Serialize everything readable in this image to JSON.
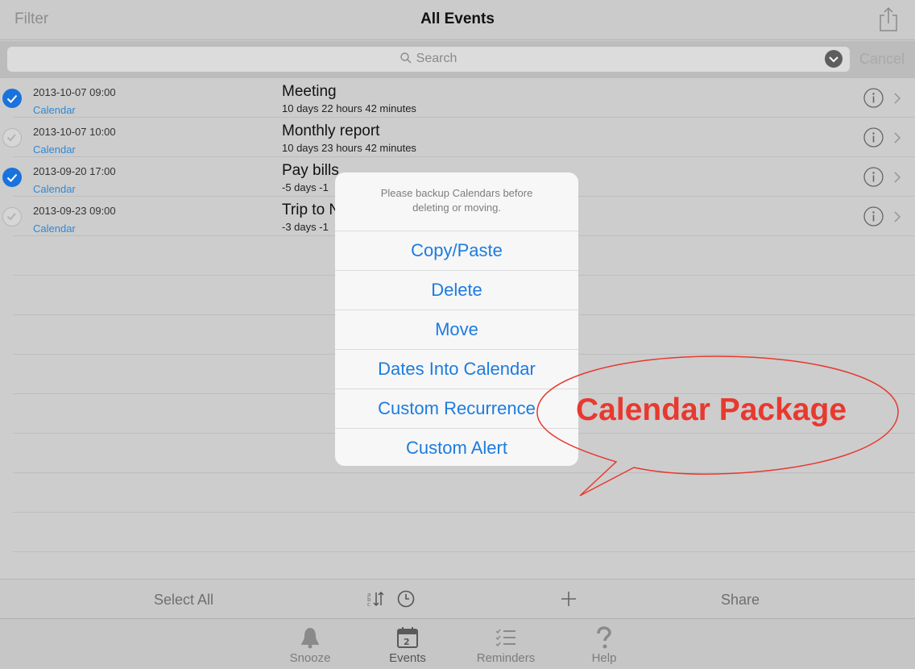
{
  "navbar": {
    "filter_label": "Filter",
    "title": "All Events",
    "share_icon": "share-icon"
  },
  "search": {
    "placeholder": "Search",
    "cancel_label": "Cancel"
  },
  "events": [
    {
      "date": "2013-10-07 09:00",
      "calendar": "Calendar",
      "title": "Meeting",
      "remaining": "10 days  22 hours  42 minutes",
      "checked": true
    },
    {
      "date": "2013-10-07 10:00",
      "calendar": "Calendar",
      "title": "Monthly report",
      "remaining": "10 days  23 hours  42 minutes",
      "checked": false
    },
    {
      "date": "2013-09-20 17:00",
      "calendar": "Calendar",
      "title": "Pay bills",
      "remaining": "-5 days  -1",
      "checked": true
    },
    {
      "date": "2013-09-23 09:00",
      "calendar": "Calendar",
      "title": "Trip to N",
      "remaining": "-3 days  -1",
      "checked": false
    }
  ],
  "popover": {
    "message": "Please backup Calendars before deleting or moving.",
    "items": [
      "Copy/Paste",
      "Delete",
      "Move",
      "Dates Into Calendar",
      "Custom Recurrence",
      "Custom Alert"
    ]
  },
  "callout": {
    "text": "Calendar Package",
    "color": "#e8392f"
  },
  "toolbar": {
    "select_all_label": "Select All",
    "share_label": "Share"
  },
  "tabs": [
    {
      "label": "Snooze",
      "icon": "bell-icon"
    },
    {
      "label": "Events",
      "icon": "calendar-icon"
    },
    {
      "label": "Reminders",
      "icon": "checklist-icon"
    },
    {
      "label": "Help",
      "icon": "question-icon"
    }
  ],
  "colors": {
    "accent": "#1c7ce0",
    "check_on": "#1a73dc",
    "calendar_link": "#2e89d6"
  }
}
